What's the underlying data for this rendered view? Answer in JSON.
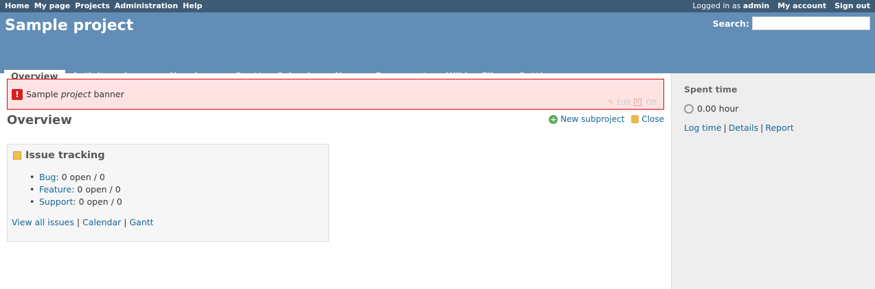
{
  "top_menu": {
    "left_items": [
      "Home",
      "My page",
      "Projects",
      "Administration",
      "Help"
    ],
    "logged_in_prefix": "Logged in as",
    "logged_in_user": "admin",
    "my_account": "My account",
    "sign_out": "Sign out"
  },
  "header": {
    "project_title": "Sample project",
    "search_label": "Search:",
    "search_value": ""
  },
  "main_menu": {
    "tabs": [
      "Overview",
      "Activity",
      "Issues",
      "New issue",
      "Gantt",
      "Calendar",
      "News",
      "Documents",
      "Wiki",
      "Files",
      "Settings"
    ],
    "selected": "Overview"
  },
  "banner": {
    "text_before": "Sample ",
    "text_em": "project",
    "text_after": " banner",
    "edit": "Edit",
    "off": "Off"
  },
  "page": {
    "title": "Overview",
    "new_subproject": "New subproject",
    "close": "Close"
  },
  "issue_tracking": {
    "title": "Issue tracking",
    "trackers": [
      {
        "name": "Bug",
        "stats": ": 0 open / 0"
      },
      {
        "name": "Feature",
        "stats": ": 0 open / 0"
      },
      {
        "name": "Support",
        "stats": ": 0 open / 0"
      }
    ],
    "links": [
      "View all issues",
      "Calendar",
      "Gantt"
    ],
    "separator": "|"
  },
  "sidebar": {
    "title": "Spent time",
    "spent": "0.00 hour",
    "links": [
      "Log time",
      "Details",
      "Report"
    ],
    "separator": "|"
  }
}
